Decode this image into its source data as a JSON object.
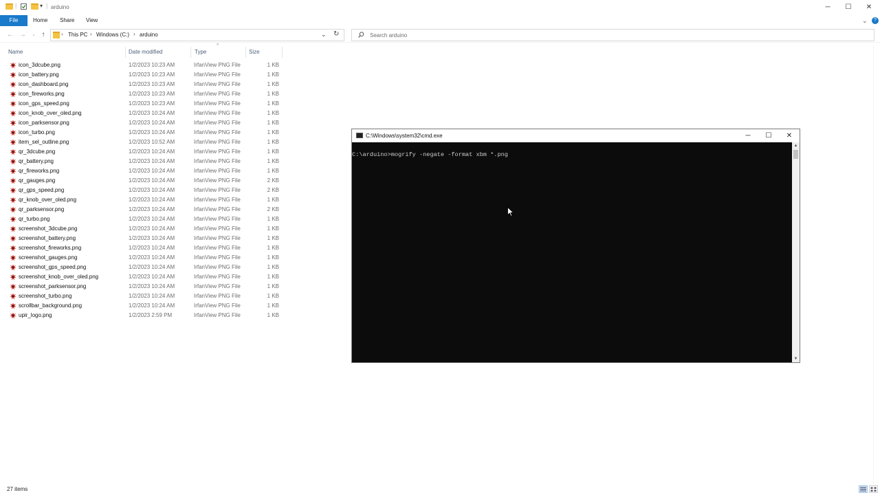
{
  "window": {
    "title": "arduino",
    "minimize": "─",
    "maximize": "☐",
    "close": "✕"
  },
  "ribbon": {
    "tabs": [
      "File",
      "Home",
      "Share",
      "View"
    ],
    "expand": "⌄",
    "help": "?"
  },
  "address": {
    "back": "←",
    "forward": "→",
    "recent": "⌄",
    "up": "↑",
    "breadcrumbs": [
      "This PC",
      "Windows (C:)",
      "arduino"
    ],
    "separator": "›",
    "dropdown": "⌄",
    "refresh": "↻"
  },
  "search": {
    "placeholder": "Search arduino",
    "icon": "search-icon"
  },
  "file_list": {
    "columns": [
      "Name",
      "Date modified",
      "Type",
      "Size"
    ],
    "sort_indicator": "^",
    "files": [
      {
        "name": "icon_3dcube.png",
        "date": "1/2/2023 10:23 AM",
        "type": "IrfanView PNG File",
        "size": "1 KB"
      },
      {
        "name": "icon_battery.png",
        "date": "1/2/2023 10:23 AM",
        "type": "IrfanView PNG File",
        "size": "1 KB"
      },
      {
        "name": "icon_dashboard.png",
        "date": "1/2/2023 10:23 AM",
        "type": "IrfanView PNG File",
        "size": "1 KB"
      },
      {
        "name": "icon_fireworks.png",
        "date": "1/2/2023 10:23 AM",
        "type": "IrfanView PNG File",
        "size": "1 KB"
      },
      {
        "name": "icon_gps_speed.png",
        "date": "1/2/2023 10:23 AM",
        "type": "IrfanView PNG File",
        "size": "1 KB"
      },
      {
        "name": "icon_knob_over_oled.png",
        "date": "1/2/2023 10:24 AM",
        "type": "IrfanView PNG File",
        "size": "1 KB"
      },
      {
        "name": "icon_parksensor.png",
        "date": "1/2/2023 10:24 AM",
        "type": "IrfanView PNG File",
        "size": "1 KB"
      },
      {
        "name": "icon_turbo.png",
        "date": "1/2/2023 10:24 AM",
        "type": "IrfanView PNG File",
        "size": "1 KB"
      },
      {
        "name": "item_sel_outline.png",
        "date": "1/2/2023 10:52 AM",
        "type": "IrfanView PNG File",
        "size": "1 KB"
      },
      {
        "name": "qr_3dcube.png",
        "date": "1/2/2023 10:24 AM",
        "type": "IrfanView PNG File",
        "size": "1 KB"
      },
      {
        "name": "qr_battery.png",
        "date": "1/2/2023 10:24 AM",
        "type": "IrfanView PNG File",
        "size": "1 KB"
      },
      {
        "name": "qr_fireworks.png",
        "date": "1/2/2023 10:24 AM",
        "type": "IrfanView PNG File",
        "size": "1 KB"
      },
      {
        "name": "qr_gauges.png",
        "date": "1/2/2023 10:24 AM",
        "type": "IrfanView PNG File",
        "size": "2 KB"
      },
      {
        "name": "qr_gps_speed.png",
        "date": "1/2/2023 10:24 AM",
        "type": "IrfanView PNG File",
        "size": "2 KB"
      },
      {
        "name": "qr_knob_over_oled.png",
        "date": "1/2/2023 10:24 AM",
        "type": "IrfanView PNG File",
        "size": "1 KB"
      },
      {
        "name": "qr_parksensor.png",
        "date": "1/2/2023 10:24 AM",
        "type": "IrfanView PNG File",
        "size": "2 KB"
      },
      {
        "name": "qr_turbo.png",
        "date": "1/2/2023 10:24 AM",
        "type": "IrfanView PNG File",
        "size": "1 KB"
      },
      {
        "name": "screenshot_3dcube.png",
        "date": "1/2/2023 10:24 AM",
        "type": "IrfanView PNG File",
        "size": "1 KB"
      },
      {
        "name": "screenshot_battery.png",
        "date": "1/2/2023 10:24 AM",
        "type": "IrfanView PNG File",
        "size": "1 KB"
      },
      {
        "name": "screenshot_fireworks.png",
        "date": "1/2/2023 10:24 AM",
        "type": "IrfanView PNG File",
        "size": "1 KB"
      },
      {
        "name": "screenshot_gauges.png",
        "date": "1/2/2023 10:24 AM",
        "type": "IrfanView PNG File",
        "size": "1 KB"
      },
      {
        "name": "screenshot_gps_speed.png",
        "date": "1/2/2023 10:24 AM",
        "type": "IrfanView PNG File",
        "size": "1 KB"
      },
      {
        "name": "screenshot_knob_over_oled.png",
        "date": "1/2/2023 10:24 AM",
        "type": "IrfanView PNG File",
        "size": "1 KB"
      },
      {
        "name": "screenshot_parksensor.png",
        "date": "1/2/2023 10:24 AM",
        "type": "IrfanView PNG File",
        "size": "1 KB"
      },
      {
        "name": "screenshot_turbo.png",
        "date": "1/2/2023 10:24 AM",
        "type": "IrfanView PNG File",
        "size": "1 KB"
      },
      {
        "name": "scrollbar_background.png",
        "date": "1/2/2023 10:24 AM",
        "type": "IrfanView PNG File",
        "size": "1 KB"
      },
      {
        "name": "upir_logo.png",
        "date": "1/2/2023 2:59 PM",
        "type": "IrfanView PNG File",
        "size": "1 KB"
      }
    ]
  },
  "status": {
    "item_count": "27 items"
  },
  "cmd": {
    "title": "C:\\Windows\\system32\\cmd.exe",
    "minimize": "─",
    "maximize": "☐",
    "close": "✕",
    "prompt_line": "C:\\arduino>mogrify -negate -format xbm *.png",
    "scroll_up": "▲",
    "scroll_down": "▼"
  },
  "colors": {
    "file_tab": "#1979ca",
    "console_bg": "#0c0c0c",
    "console_text": "#cccccc",
    "folder": "#f5c342",
    "irfanview_icon": "#c8281e"
  }
}
